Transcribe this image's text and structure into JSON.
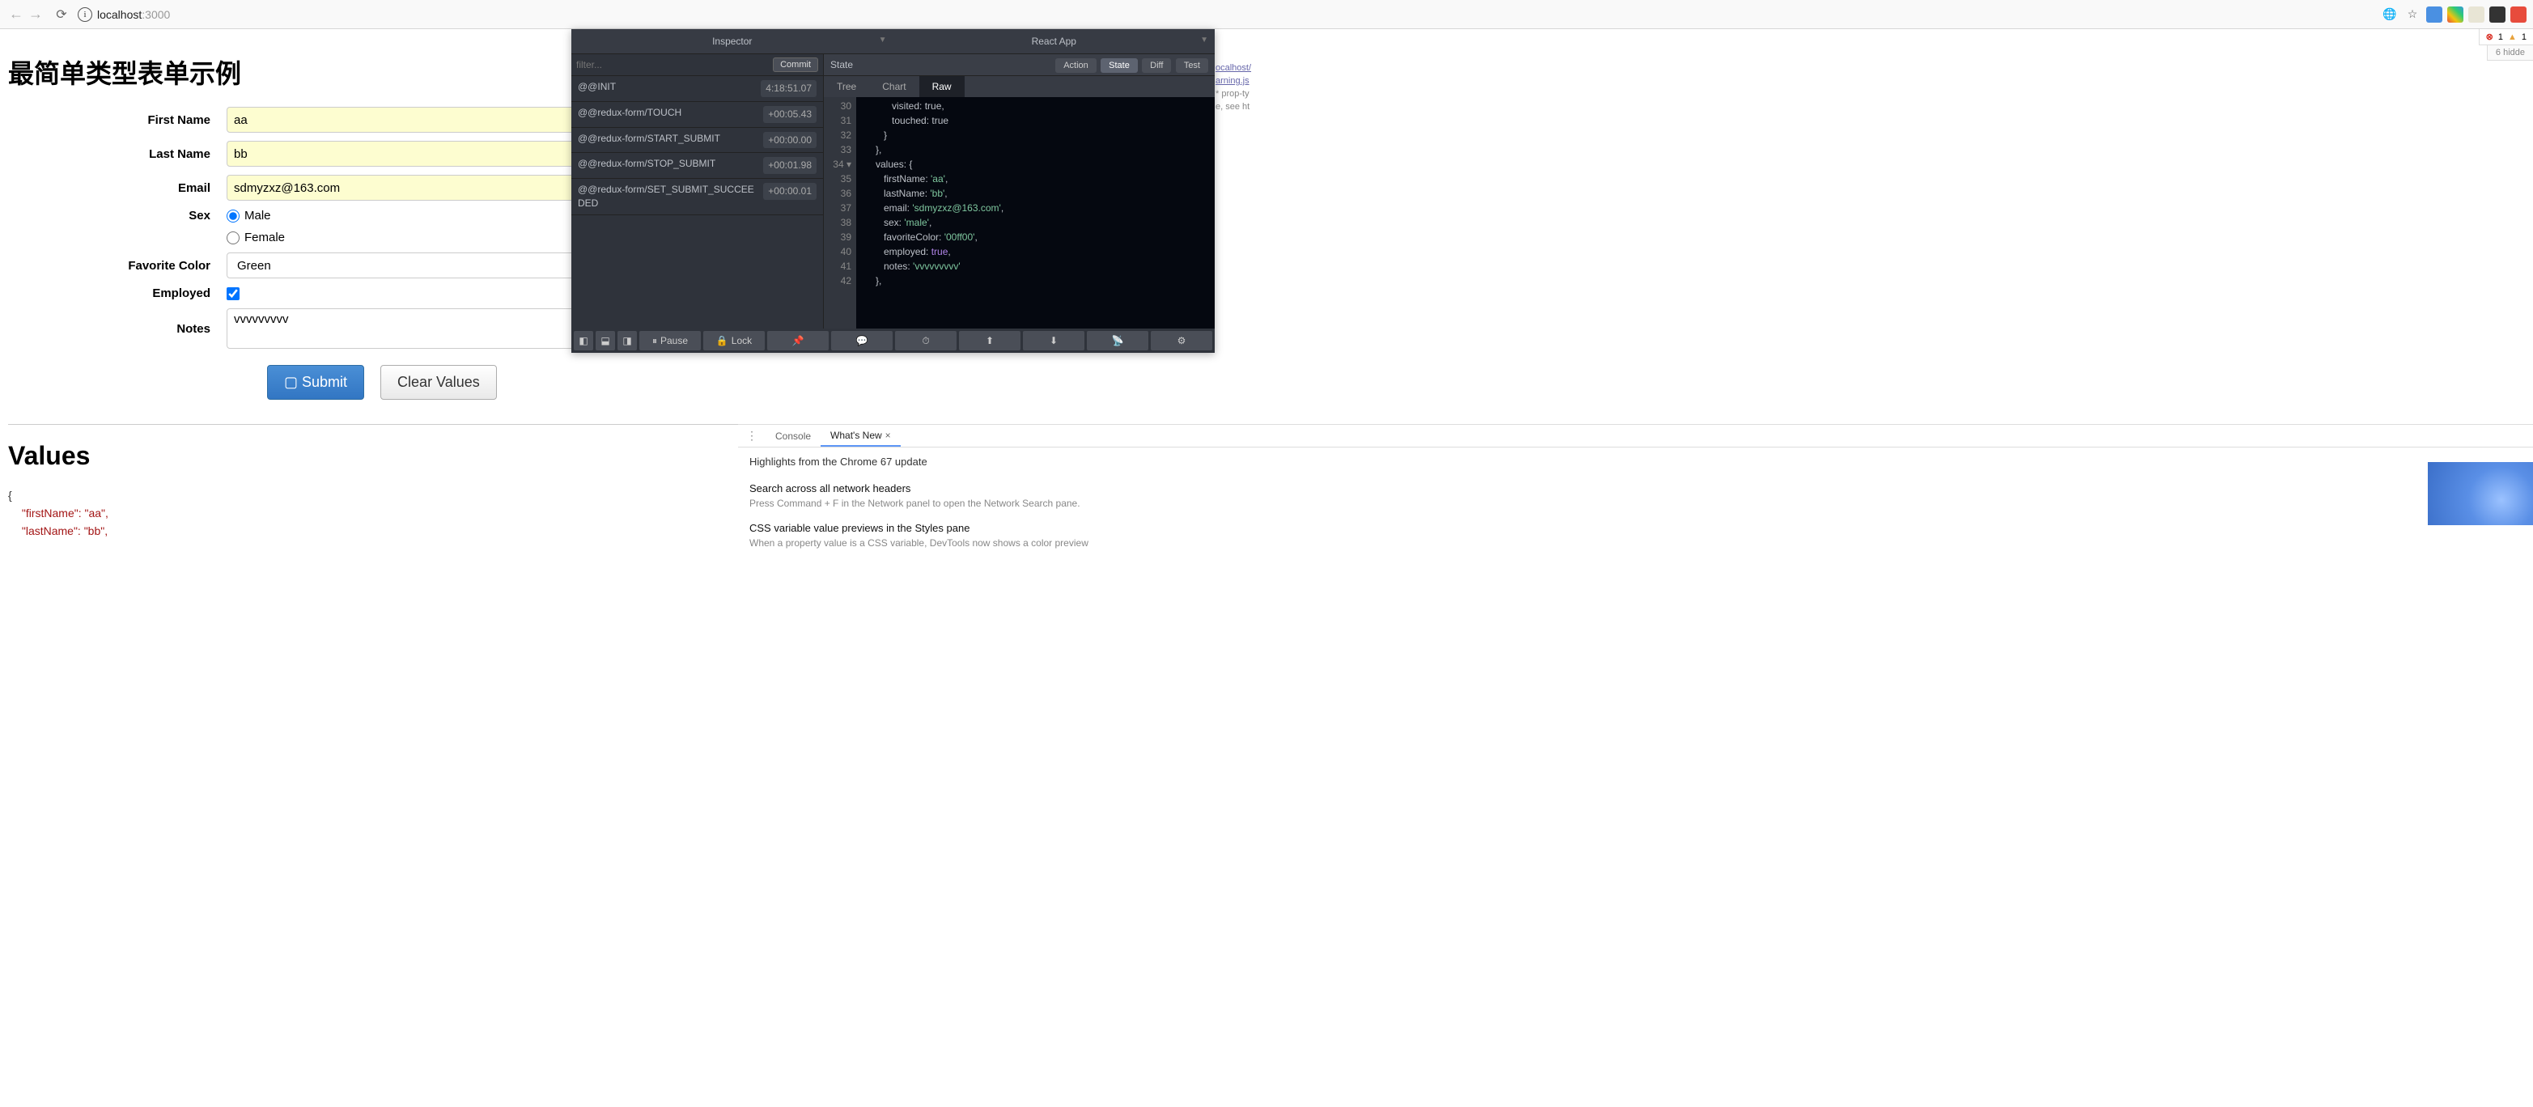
{
  "browser": {
    "host": "localhost",
    "port": ":3000",
    "errors": "1",
    "warnings": "1",
    "hidden": "6 hidde"
  },
  "page": {
    "title": "最简单类型表单示例",
    "labels": {
      "firstName": "First Name",
      "lastName": "Last Name",
      "email": "Email",
      "sex": "Sex",
      "male": "Male",
      "female": "Female",
      "favoriteColor": "Favorite Color",
      "employed": "Employed",
      "notes": "Notes"
    },
    "values": {
      "firstName": "aa",
      "lastName": "bb",
      "email": "sdmyzxz@163.com",
      "favoriteColor": "Green",
      "notes": "vvvvvvvvv"
    },
    "buttons": {
      "submit": "Submit",
      "clear": "Clear Values"
    },
    "valuesTitle": "Values",
    "jsonPreview": {
      "firstName": "\"firstName\": \"aa\",",
      "lastName": "\"lastName\": \"bb\","
    }
  },
  "devtools": {
    "tabs": {
      "inspector": "Inspector",
      "reactApp": "React App"
    },
    "filter": {
      "placeholder": "filter...",
      "commit": "Commit"
    },
    "actions": [
      {
        "name": "@@INIT",
        "time": "4:18:51.07"
      },
      {
        "name": "@@redux-form/TOUCH",
        "time": "+00:05.43"
      },
      {
        "name": "@@redux-form/START_SUBMIT",
        "time": "+00:00.00"
      },
      {
        "name": "@@redux-form/STOP_SUBMIT",
        "time": "+00:01.98"
      },
      {
        "name": "@@redux-form/SET_SUBMIT_SUCCEEDED",
        "time": "+00:00.01"
      }
    ],
    "stateLabel": "State",
    "modes": {
      "action": "Action",
      "state": "State",
      "diff": "Diff",
      "test": "Test"
    },
    "subtabs": {
      "tree": "Tree",
      "chart": "Chart",
      "raw": "Raw"
    },
    "code": {
      "lines": [
        "30",
        "31",
        "32",
        "33",
        "34 ▾",
        "35",
        "36",
        "37",
        "38",
        "39",
        "40",
        "41",
        "42"
      ],
      "l30": "            visited: true,",
      "l31": "            touched: true",
      "l32": "         }",
      "l33": "      },",
      "l34": "      values: {",
      "l35a": "         firstName: ",
      "l35b": "'aa'",
      "l36a": "         lastName: ",
      "l36b": "'bb'",
      "l37a": "         email: ",
      "l37b": "'sdmyzxz@163.com'",
      "l38a": "         sex: ",
      "l38b": "'male'",
      "l39a": "         favoriteColor: ",
      "l39b": "'00ff00'",
      "l40a": "         employed: ",
      "l40b": "true",
      "l41a": "         notes: ",
      "l41b": "'vvvvvvvvv'",
      "l42": "      },"
    },
    "bottom": {
      "pause": "Pause",
      "lock": "Lock"
    }
  },
  "drawer": {
    "tabs": {
      "console": "Console",
      "whatsNew": "What's New"
    },
    "highlights": "Highlights from the Chrome 67 update",
    "h1": "Search across all network headers",
    "h1sub": "Press Command + F in the Network panel to open the Network Search pane.",
    "h2": "CSS variable value previews in the Styles pane",
    "h2sub": "When a property value is a CSS variable, DevTools now shows a color preview"
  },
  "sideConsole": {
    "l1": "ocalhost/",
    "l2": "arning.js",
    "l3": "* prop-ty",
    "l4": "e, see ht"
  }
}
